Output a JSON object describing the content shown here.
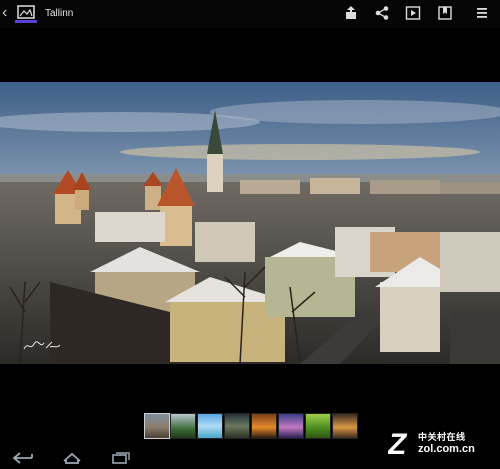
{
  "topbar": {
    "title": "Tallinn",
    "actions": [
      {
        "name": "share-upload-icon"
      },
      {
        "name": "share-icon"
      },
      {
        "name": "slideshow-play-icon"
      },
      {
        "name": "bookmark-icon"
      },
      {
        "name": "menu-icon"
      }
    ]
  },
  "photo": {
    "signature": "signature"
  },
  "filmstrip": {
    "selected_index": 0,
    "count": 8
  },
  "navbar": {
    "items": [
      {
        "name": "back-nav-icon"
      },
      {
        "name": "home-nav-icon"
      },
      {
        "name": "recent-apps-icon"
      }
    ]
  },
  "watermark": {
    "cn": "中关村在线",
    "url": "zol.com.cn"
  },
  "colors": {
    "accent": "#5b3fd6",
    "background": "#000000"
  }
}
